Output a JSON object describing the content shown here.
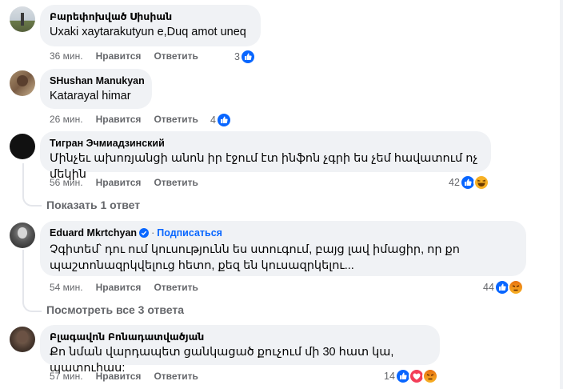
{
  "comments": [
    {
      "author": "Բարեփոխված Սիսիան",
      "text": "Uxaki xaytarakutyun e,Duq amot uneq",
      "time": "36 мин.",
      "like": "Нравится",
      "reply": "Ответить",
      "reactions_count": "3",
      "reaction_icons": [
        "like-icon"
      ]
    },
    {
      "author": "SHushan Manukyan",
      "text": "Katarayal himar",
      "time": "26 мин.",
      "like": "Нравится",
      "reply": "Ответить",
      "reactions_count": "4",
      "reaction_icons": [
        "like-icon"
      ]
    },
    {
      "author": "Тигран Эчмиадзинский",
      "text": "Մինչեւ ախոռյանցի անոն իր էջում էտ ինֆոն չգրի ես չեմ հավատում ոչ մեկին",
      "time": "56 мин.",
      "like": "Нравится",
      "reply": "Ответить",
      "reactions_count": "42",
      "reaction_icons": [
        "like-icon",
        "haha-icon"
      ],
      "replies_link": "Показать 1 ответ"
    },
    {
      "author": "Eduard Mkrtchyan",
      "follow": "Подписаться",
      "separator": "·",
      "text_line1": "Չգիտեմ՝ դու ում կուսությունն ես ստուգում, բայց լավ իմացիր, որ քո",
      "text_line2": "պաշտոնազրկվելուց հետո, քեզ են կուսազրկելու...",
      "time": "54 мин.",
      "like": "Нравится",
      "reply": "Ответить",
      "reactions_count": "44",
      "reaction_icons": [
        "like-icon",
        "angry-icon"
      ],
      "replies_link": "Посмотреть все 3 ответа"
    },
    {
      "author": "Բլագավոն Բոնադատվածյան",
      "text": "Քո նման վարդապետ ցանկացած քուչում մի 30 հատ կա, պատուհաս:",
      "time": "57 мин.",
      "like": "Нравится",
      "reply": "Ответить",
      "reactions_count": "14",
      "reaction_icons": [
        "like-icon",
        "love-icon",
        "angry-icon"
      ]
    }
  ],
  "colors": {
    "bubble": "#f0f2f5",
    "meta": "#65676b",
    "like_blue": "#0866ff",
    "love_red": "#f33e58",
    "angry_orange": "#e9710f",
    "haha_yellow": "#f7b125"
  }
}
